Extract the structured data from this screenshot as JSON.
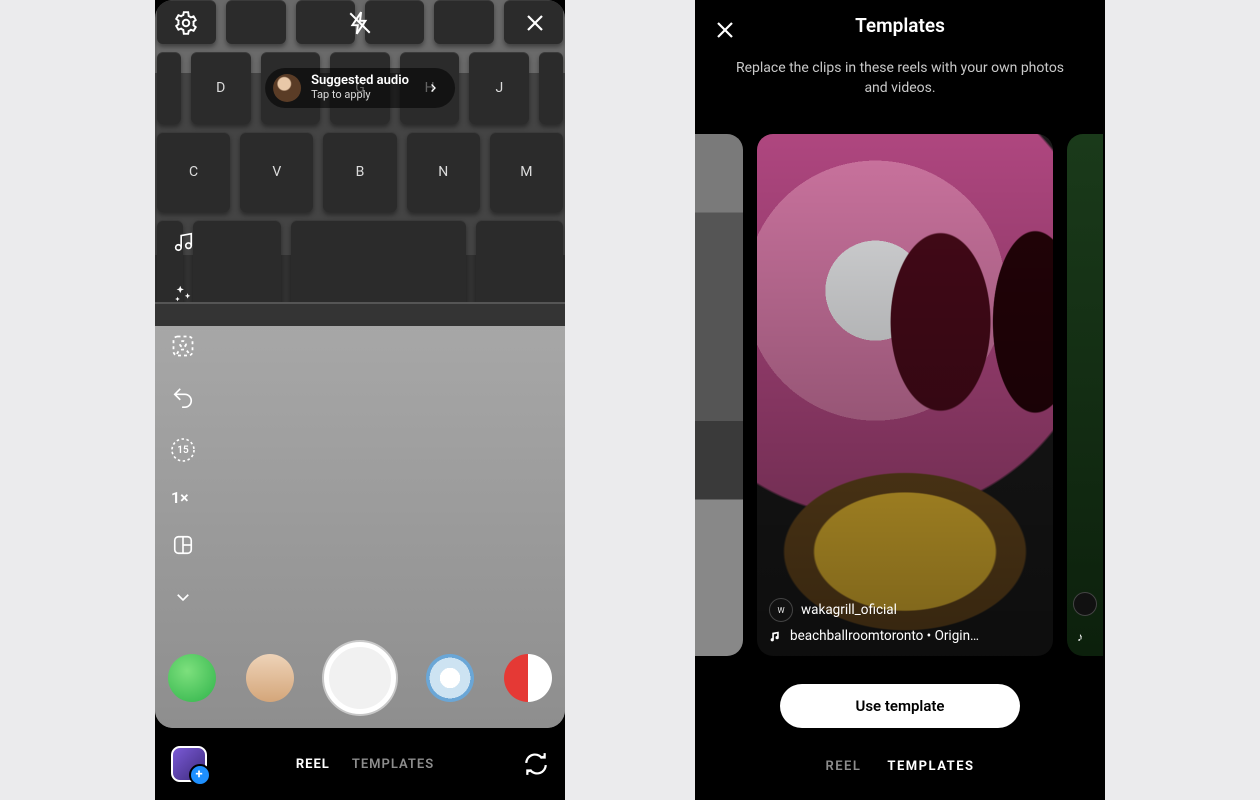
{
  "screen1": {
    "topbar": {
      "settings_icon": "settings",
      "flash_icon": "flash-off",
      "close_icon": "close"
    },
    "audio_pill": {
      "title": "Suggested audio",
      "subtitle": "Tap to apply"
    },
    "toolrail": {
      "music_icon": "music",
      "effects_icon": "sparkles",
      "greenscreen_icon": "person-scan",
      "undo_icon": "undo",
      "timer_label": "15",
      "speed_label": "1×",
      "layout_icon": "layout",
      "more_icon": "chevron-down"
    },
    "effects_row": {
      "items": [
        "green",
        "selfie",
        "capture",
        "umbrella",
        "redwhite"
      ]
    },
    "bottombar": {
      "tabs": [
        "REEL",
        "TEMPLATES"
      ],
      "active_tab": "REEL"
    }
  },
  "screen2": {
    "title": "Templates",
    "subtitle": "Replace the clips in these reels with your own photos and videos.",
    "main_card": {
      "author": "wakagrill_oficial",
      "audio": "beachballroomtoronto • Origin…"
    },
    "cta": "Use template",
    "tabs": [
      "REEL",
      "TEMPLATES"
    ],
    "active_tab": "TEMPLATES"
  }
}
